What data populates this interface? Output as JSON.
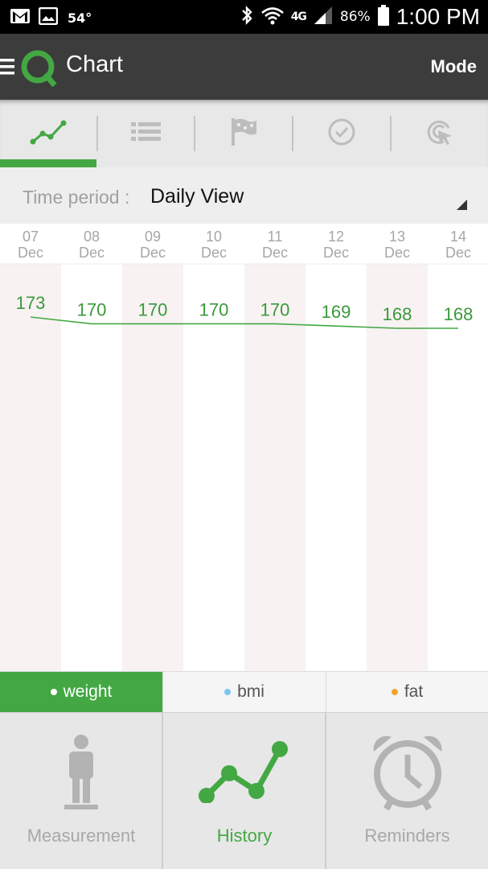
{
  "status_bar": {
    "temperature": "54°",
    "network": "4G",
    "battery": "86%",
    "time": "1:00 PM"
  },
  "app_bar": {
    "title": "Chart",
    "mode_label": "Mode"
  },
  "tabs": [
    {
      "icon": "line-chart-icon",
      "active": true
    },
    {
      "icon": "list-icon",
      "active": false
    },
    {
      "icon": "flag-icon",
      "active": false
    },
    {
      "icon": "check-circle-icon",
      "active": false
    },
    {
      "icon": "target-cursor-icon",
      "active": false
    }
  ],
  "time_period": {
    "label": "Time period :",
    "value": "Daily View"
  },
  "chart_data": {
    "type": "line",
    "x": [
      {
        "day": "07",
        "month": "Dec"
      },
      {
        "day": "08",
        "month": "Dec"
      },
      {
        "day": "09",
        "month": "Dec"
      },
      {
        "day": "10",
        "month": "Dec"
      },
      {
        "day": "11",
        "month": "Dec"
      },
      {
        "day": "12",
        "month": "Dec"
      },
      {
        "day": "13",
        "month": "Dec"
      },
      {
        "day": "14",
        "month": "Dec"
      }
    ],
    "series": [
      {
        "name": "weight",
        "values": [
          173,
          170,
          170,
          170,
          170,
          169,
          168,
          168
        ]
      }
    ],
    "line_color": "#43a843",
    "label_color": "#3a9a3a"
  },
  "metric_tabs": [
    {
      "label": "weight",
      "dot_color": "#ffffff",
      "active": true
    },
    {
      "label": "bmi",
      "dot_color": "#7cc4ee",
      "active": false
    },
    {
      "label": "fat",
      "dot_color": "#f0a52a",
      "active": false
    }
  ],
  "bottom_nav": [
    {
      "label": "Measurement",
      "icon": "person-scale-icon",
      "active": false,
      "color": "#a8a8a8"
    },
    {
      "label": "History",
      "icon": "history-chart-icon",
      "active": true,
      "color": "#43a843"
    },
    {
      "label": "Reminders",
      "icon": "alarm-clock-icon",
      "active": false,
      "color": "#a8a8a8"
    }
  ],
  "colors": {
    "accent": "#43a843",
    "app_bar": "#3c3c3c",
    "inactive_icon": "#bdbdbd"
  }
}
